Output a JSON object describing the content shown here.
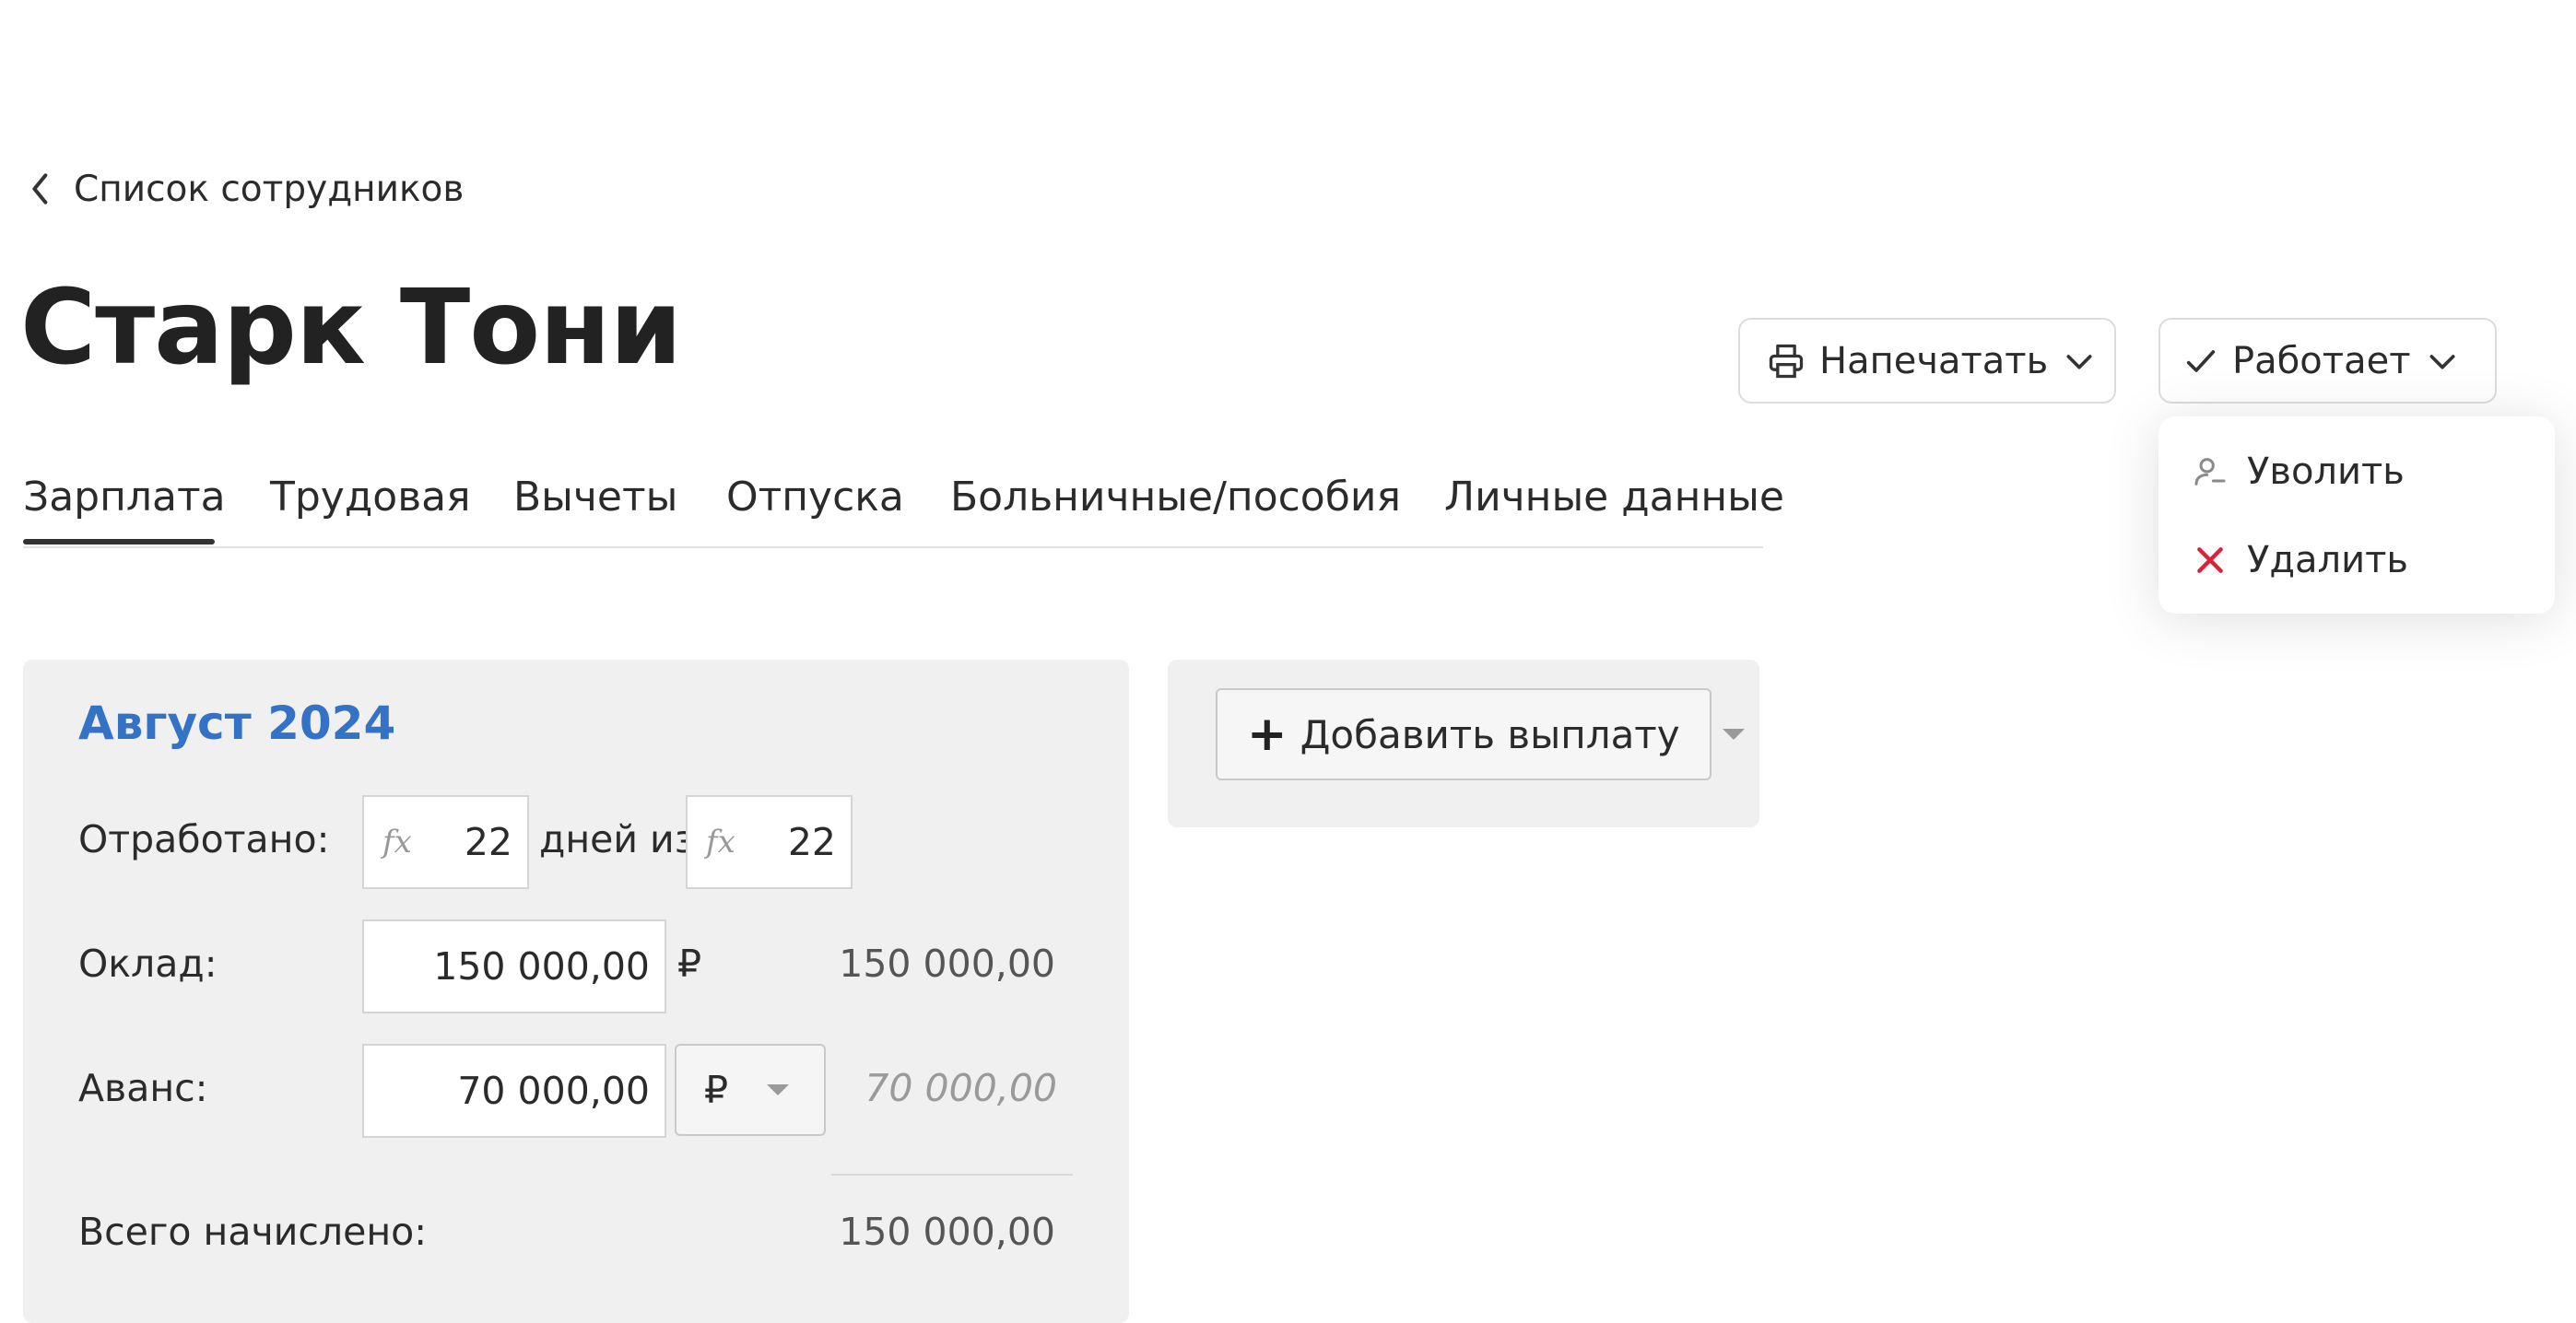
{
  "back_link": {
    "label": "Список сотрудников"
  },
  "employee": {
    "name": "Старк Тони"
  },
  "actions": {
    "print_label": "Напечатать",
    "status_label": "Работает"
  },
  "status_menu": {
    "items": [
      {
        "label": "Уволить",
        "icon": "user-minus-icon"
      },
      {
        "label": "Удалить",
        "icon": "close-icon",
        "color": "#d9233a"
      }
    ]
  },
  "tabs": [
    {
      "label": "Зарплата",
      "active": true
    },
    {
      "label": "Трудовая"
    },
    {
      "label": "Вычеты"
    },
    {
      "label": "Отпуска"
    },
    {
      "label": "Больничные/пособия"
    },
    {
      "label": "Личные данные"
    }
  ],
  "payroll": {
    "month": "Август 2024",
    "worked": {
      "label": "Отработано:",
      "fx_symbol": "fx",
      "days_worked": "22",
      "middle_text": "дней из",
      "days_total": "22"
    },
    "salary": {
      "label": "Оклад:",
      "value": "150 000,00",
      "currency": "₽",
      "amount": "150 000,00"
    },
    "advance": {
      "label": "Аванс:",
      "value": "70 000,00",
      "currency": "₽",
      "amount": "70 000,00"
    },
    "total": {
      "label": "Всего начислено:",
      "amount": "150 000,00"
    }
  },
  "payments": {
    "add_label": "Добавить выплату"
  },
  "colors": {
    "accent": "#3472c5",
    "danger": "#d9233a",
    "card_bg": "#f0f0f0"
  }
}
